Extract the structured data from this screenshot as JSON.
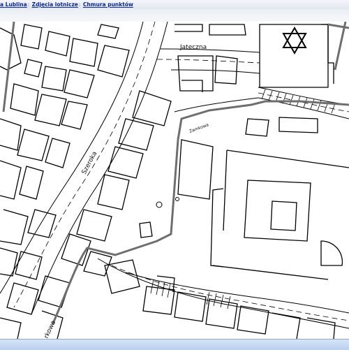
{
  "breadcrumb": {
    "items": [
      {
        "label": "a Lublina"
      },
      {
        "label": "Zdjęcia lotnicze"
      },
      {
        "label": "Chmura punktów"
      }
    ],
    "separator": ":"
  },
  "map": {
    "streets": [
      {
        "name": "Jateczna"
      },
      {
        "name": "Szeroka"
      },
      {
        "name": "Zamkowa"
      },
      {
        "name": "rkowa"
      }
    ],
    "route_color": "#6e6e6e",
    "line_color": "#000000"
  },
  "icons": [
    "star-of-david-icon"
  ]
}
